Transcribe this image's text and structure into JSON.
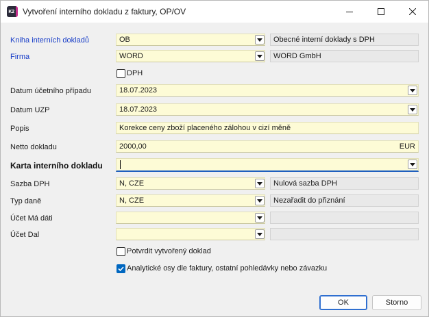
{
  "window": {
    "title": "Vytvoření interního dokladu z faktury, OP/OV",
    "app_icon_text": "K2"
  },
  "form": {
    "kniha": {
      "label": "Kniha interních dokladů",
      "value": "OB",
      "description": "Obecné interní doklady s DPH"
    },
    "firma": {
      "label": "Firma",
      "value": "WORD",
      "description": "WORD GmbH"
    },
    "dph": {
      "label": "DPH",
      "checked": false
    },
    "datum_ucetniho_pripadu": {
      "label": "Datum účetního případu",
      "value": "18.07.2023"
    },
    "datum_uzp": {
      "label": "Datum UZP",
      "value": "18.07.2023"
    },
    "popis": {
      "label": "Popis",
      "value": "Korekce ceny zboží placeného zálohou v cizí měně"
    },
    "netto": {
      "label": "Netto dokladu",
      "value": "2000,00",
      "currency": "EUR"
    },
    "karta": {
      "label": "Karta interního dokladu",
      "value": ""
    },
    "sazba_dph": {
      "label": "Sazba DPH",
      "value": "N, CZE",
      "description": "Nulová sazba DPH"
    },
    "typ_dane": {
      "label": "Typ daně",
      "value": "N, CZE",
      "description": "Nezařadit do přiznání"
    },
    "ucet_ma_dati": {
      "label": "Účet Má dáti",
      "value": "",
      "description": ""
    },
    "ucet_dal": {
      "label": "Účet Dal",
      "value": "",
      "description": ""
    },
    "potvrdit": {
      "label": "Potvrdit vytvořený doklad",
      "checked": false
    },
    "analyticke_osy": {
      "label": "Analytické osy dle faktury, ostatní pohledávky nebo závazku",
      "checked": true
    }
  },
  "buttons": {
    "ok": "OK",
    "storno": "Storno"
  },
  "colors": {
    "input_background": "#fdfbd6",
    "link_label": "#1a3fc8",
    "accent": "#0067c0"
  }
}
